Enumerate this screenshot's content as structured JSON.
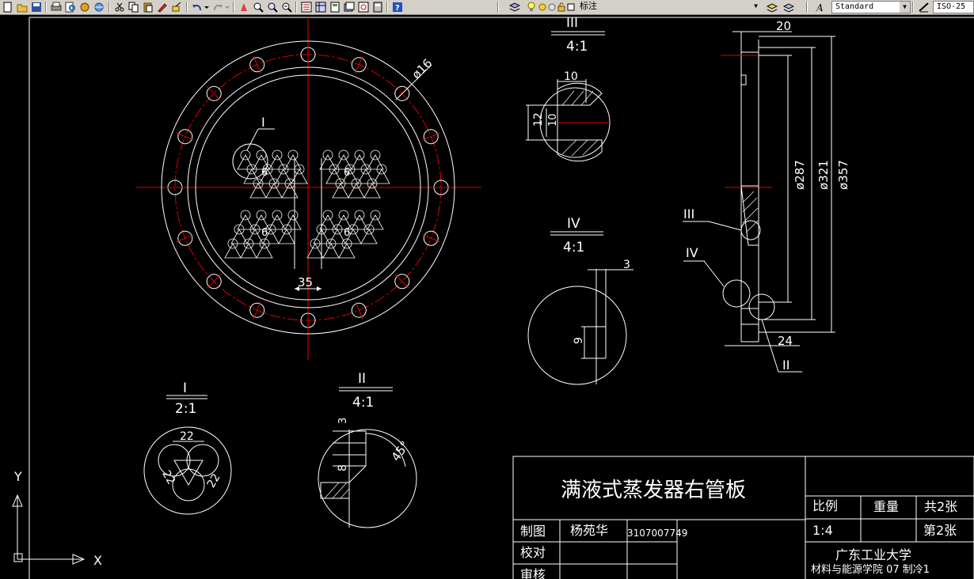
{
  "toolbar": {
    "layer_name": "标注",
    "text_style": "Standard",
    "dim_style": "ISO-25"
  },
  "drawing": {
    "main_view": {
      "dia_label": "ø16",
      "detail_I_tag": "I",
      "dim_35": "35",
      "hole_group_label": "6"
    },
    "detail_III": {
      "title": "III",
      "scale": "4:1",
      "dim_10_top": "10",
      "dim_12": "12",
      "dim_10_inner": "10"
    },
    "detail_IV": {
      "title": "IV",
      "scale": "4:1",
      "dim_3": "3",
      "dim_9": "9"
    },
    "detail_I": {
      "title": "I",
      "scale": "2:1",
      "dim_22_top": "22",
      "dim_22_left": "22",
      "dim_22_right": "22"
    },
    "detail_II": {
      "title": "II",
      "scale": "4:1",
      "dim_3": "3",
      "dim_8": "8",
      "dim_45": "45°"
    },
    "side_view": {
      "dim_20": "20",
      "dim_287": "ø287",
      "dim_321": "ø321",
      "dim_357": "ø357",
      "dim_24": "24",
      "tag_III": "III",
      "tag_IV": "IV",
      "tag_II": "II"
    },
    "ucs": {
      "y_label": "Y",
      "x_label": "X"
    },
    "title_block": {
      "title": "满液式蒸发器右管板",
      "scale_label": "比例",
      "weight_label": "重量",
      "total_sheets": "共2张",
      "scale_value": "1:4",
      "sheet_no": "第2张",
      "drawn_label": "制图",
      "drawn_name": "杨苑华",
      "drawn_id": "3107007749",
      "check_label": "校对",
      "review_label": "审核",
      "university": "广东工业大学",
      "department": "材料与能源学院 07 制冷1"
    }
  }
}
